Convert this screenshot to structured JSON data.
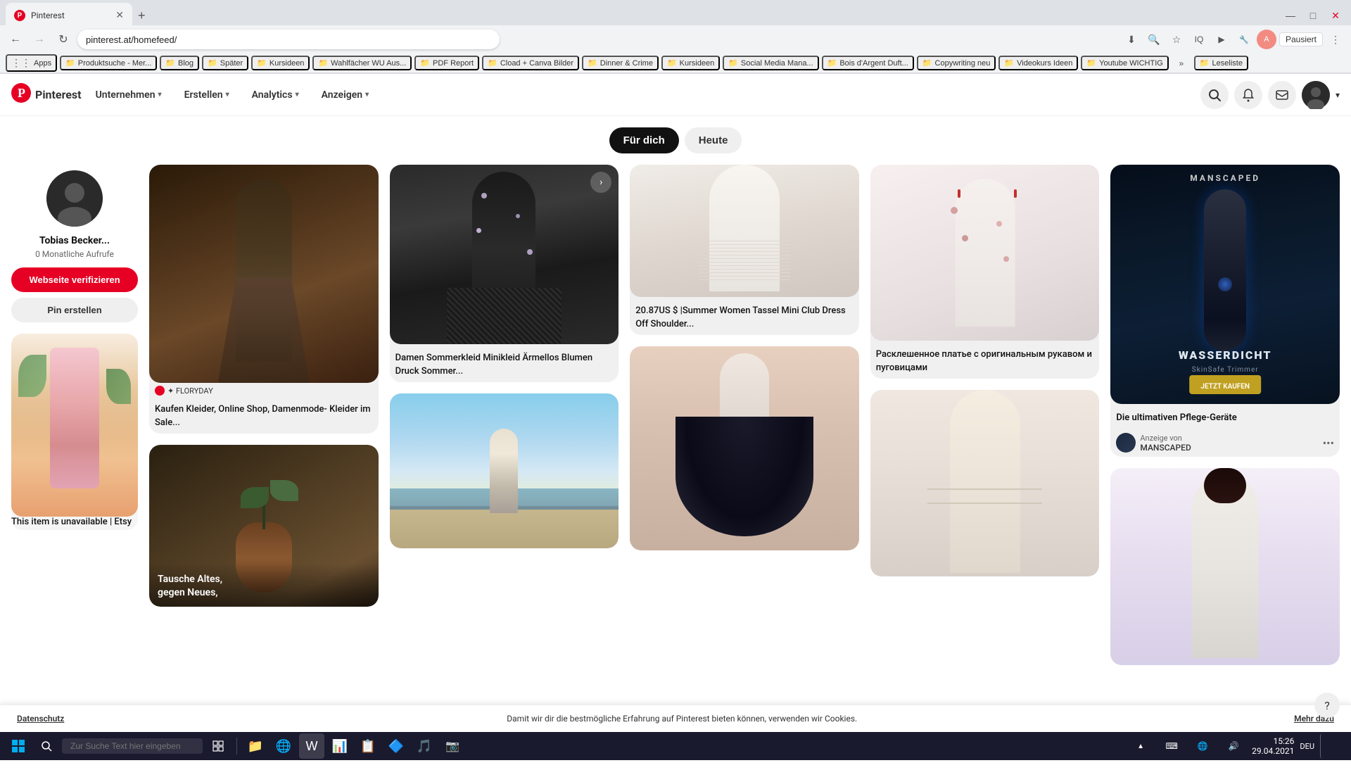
{
  "browser": {
    "tab_title": "Pinterest",
    "address": "pinterest.at/homefeed/",
    "paused_label": "Pausiert",
    "new_tab_symbol": "+",
    "back_symbol": "←",
    "forward_symbol": "→",
    "reload_symbol": "↻"
  },
  "bookmarks": [
    {
      "label": "Apps",
      "type": "apps"
    },
    {
      "label": "Produktsuche - Mer...",
      "type": "folder"
    },
    {
      "label": "Blog",
      "type": "folder"
    },
    {
      "label": "Später",
      "type": "folder"
    },
    {
      "label": "Kursideen",
      "type": "folder"
    },
    {
      "label": "Wahlfächer WU Aus...",
      "type": "folder"
    },
    {
      "label": "PDF Report",
      "type": "folder"
    },
    {
      "label": "Cload + Canva Bilder",
      "type": "folder"
    },
    {
      "label": "Dinner & Crime",
      "type": "folder"
    },
    {
      "label": "Kursideen",
      "type": "folder"
    },
    {
      "label": "Social Media Mana...",
      "type": "folder"
    },
    {
      "label": "Bois d'Argent Duft...",
      "type": "folder"
    },
    {
      "label": "Copywriting neu",
      "type": "folder"
    },
    {
      "label": "Videokurs Ideen",
      "type": "folder"
    },
    {
      "label": "Youtube WICHTIG",
      "type": "folder"
    },
    {
      "label": "Leseliste",
      "type": "folder"
    }
  ],
  "header": {
    "logo_text": "Pinterest",
    "nav_items": [
      {
        "label": "Unternehmen",
        "has_arrow": true
      },
      {
        "label": "Erstellen",
        "has_arrow": true
      },
      {
        "label": "Analytics",
        "has_arrow": true
      },
      {
        "label": "Anzeigen",
        "has_arrow": true
      }
    ]
  },
  "feed_tabs": [
    {
      "label": "Für dich",
      "active": true
    },
    {
      "label": "Heute",
      "active": false
    }
  ],
  "sidebar": {
    "profile_name": "Tobias Becker...",
    "monthly_views": "0 Monatliche Aufrufe",
    "verify_btn": "Webseite verifizieren",
    "create_pin_btn": "Pin erstellen",
    "pin_title": "This item is unavailable | Etsy"
  },
  "pins": [
    {
      "id": 1,
      "bg_class": "pin-bg-1",
      "title": "Kaufen Kleider, Online Shop, Damenmode- Kleider im Sale...",
      "source": "FLORYDAY",
      "has_source_logo": true,
      "col": 1
    },
    {
      "id": 2,
      "bg_class": "pin-bg-2",
      "title": "Damen Sommerkleid Minikleid Ärmellos Blumen Druck Sommer...",
      "source": "",
      "col": 2
    },
    {
      "id": 3,
      "bg_class": "pin-bg-3",
      "title": "20.87US $ |Summer Women Tassel Mini Club Dress Off Shoulder...",
      "source": "",
      "col": 3
    },
    {
      "id": 4,
      "bg_class": "pin-bg-4",
      "title": "Расклешенное платье с оригинальным рукавом и пуговицами",
      "source": "",
      "col": 4
    },
    {
      "id": 5,
      "bg_class": "pin-bg-5",
      "title": "Die ultimativen Pflege-Geräte",
      "ad_label": "Anzeige von",
      "ad_name": "MANSCAPED",
      "is_ad": true,
      "col": 5
    },
    {
      "id": 6,
      "bg_class": "pin-bg-7",
      "title": "Tausche Altes, gegen Neues...",
      "overlay_text": "Tausche Altes,\ngegen Neues,",
      "col": 1
    },
    {
      "id": 7,
      "bg_class": "pin-bg-6",
      "title": "",
      "col": 2
    },
    {
      "id": 8,
      "bg_class": "pin-bg-9",
      "title": "",
      "col": 3
    },
    {
      "id": 9,
      "bg_class": "pin-bg-14",
      "title": "",
      "col": 4
    },
    {
      "id": 10,
      "bg_class": "pin-bg-16",
      "title": "",
      "col": 5
    }
  ],
  "cookie_bar": {
    "text": "Datenschutz",
    "message": "Damit wir dir die bestmögliche Erfahrung auf Pinterest bieten können, verwenden wir Cookies.",
    "more_info": "Mehr dazu"
  },
  "taskbar": {
    "search_placeholder": "Zur Suche Text hier eingeben",
    "time": "15:26",
    "date": "29.04.2021",
    "language": "DEU"
  },
  "icons": {
    "pinterest_p": "P",
    "search": "🔍",
    "bell": "🔔",
    "message": "💬",
    "chevron_down": "▾",
    "more": "•••",
    "question": "?",
    "windows": "⊞",
    "apps_icon": "⋮⋮"
  }
}
